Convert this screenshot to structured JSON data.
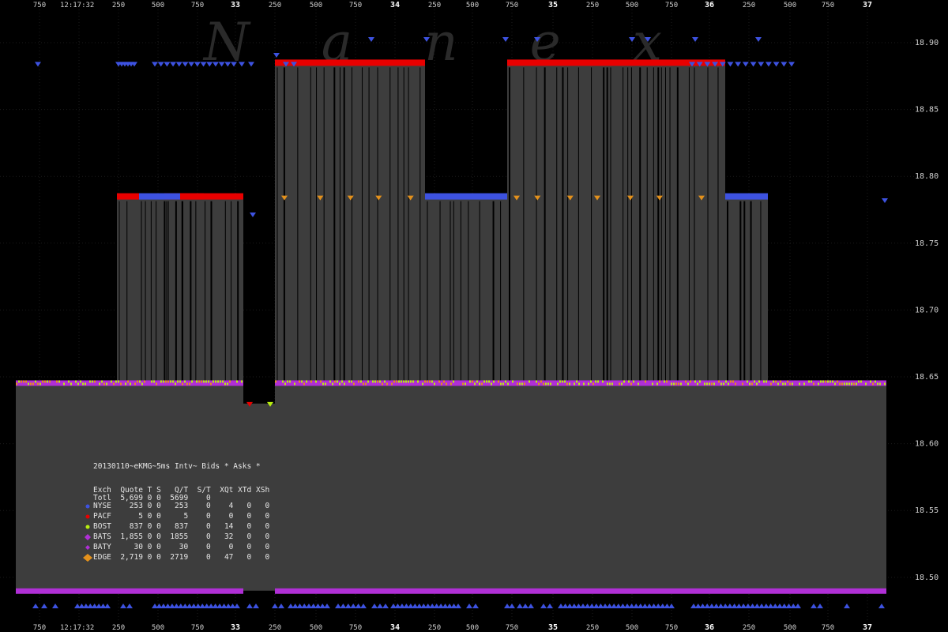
{
  "watermark": "N a n e x",
  "colors": {
    "nyse": "#3d52e0",
    "pacf": "#e80000",
    "bost": "#b8ee10",
    "bats": "#b02fd6",
    "baty": "#b02fd6",
    "edge": "#e3911c",
    "spread_fill": "#3d3d3d",
    "background": "#000000"
  },
  "chart_data": {
    "type": "quote-spread-timeline",
    "time_label": "12:17:32",
    "x_ticks": [
      "750",
      "250",
      "500",
      "750",
      "33",
      "250",
      "500",
      "750",
      "34",
      "250",
      "500",
      "750",
      "35",
      "250",
      "500",
      "750",
      "36",
      "250",
      "500",
      "750",
      "37"
    ],
    "y_ticks": [
      "18.90",
      "18.85",
      "18.80",
      "18.75",
      "18.70",
      "18.65",
      "18.60",
      "18.55",
      "18.50"
    ],
    "ylim": [
      18.48,
      18.91
    ],
    "ask_segments": [
      {
        "x0": 32.55,
        "x1": 32.8,
        "price": 18.785,
        "exch": "pacf"
      },
      {
        "x0": 32.25,
        "x1": 32.39,
        "price": 18.785,
        "exch": "pacf"
      },
      {
        "x0": 32.39,
        "x1": 32.65,
        "price": 18.785,
        "exch": "nyse"
      },
      {
        "x0": 32.65,
        "x1": 33.05,
        "price": 18.785,
        "exch": "pacf"
      },
      {
        "x0": 33.25,
        "x1": 34.2,
        "price": 18.885,
        "exch": "pacf"
      },
      {
        "x0": 34.2,
        "x1": 34.72,
        "price": 18.785,
        "exch": "nyse"
      },
      {
        "x0": 34.72,
        "x1": 35.89,
        "price": 18.885,
        "exch": "pacf"
      },
      {
        "x0": 35.89,
        "x1": 36.1,
        "price": 18.885,
        "exch": "pacf"
      },
      {
        "x0": 36.1,
        "x1": 36.37,
        "price": 18.785,
        "exch": "nyse"
      }
    ],
    "bid_level": 18.645,
    "bid_dip": {
      "x0": 33.05,
      "x1": 33.25,
      "price": 18.63
    },
    "lower_band_price": 18.49,
    "legend": {
      "title": "20130110~eKMG~5ms Intv~ Bids * Asks *",
      "headers": [
        "Exch",
        "Quote",
        "T",
        "S",
        "Q/T",
        "S/T",
        "XQt",
        "XTd",
        "XSh"
      ],
      "total": {
        "exch": "Totl",
        "quote": "5,699",
        "t": "0",
        "s": "0",
        "qt": "5699",
        "st": "0",
        "xqt": "",
        "xtd": "",
        "xsh": ""
      },
      "rows": [
        {
          "exch": "NYSE",
          "quote": "253",
          "t": "0",
          "s": "0",
          "qt": "253",
          "st": "0",
          "xqt": "4",
          "xtd": "0",
          "xsh": "0",
          "color": "#3d52e0",
          "marker": "circle"
        },
        {
          "exch": "PACF",
          "quote": "5",
          "t": "0",
          "s": "0",
          "qt": "5",
          "st": "0",
          "xqt": "0",
          "xtd": "0",
          "xsh": "0",
          "color": "#e80000",
          "marker": "circle"
        },
        {
          "exch": "BOST",
          "quote": "837",
          "t": "0",
          "s": "0",
          "qt": "837",
          "st": "0",
          "xqt": "14",
          "xtd": "0",
          "xsh": "0",
          "color": "#b8ee10",
          "marker": "circle"
        },
        {
          "exch": "BATS",
          "quote": "1,855",
          "t": "0",
          "s": "0",
          "qt": "1855",
          "st": "0",
          "xqt": "32",
          "xtd": "0",
          "xsh": "0",
          "color": "#b02fd6",
          "marker": "diamond"
        },
        {
          "exch": "BATY",
          "quote": "30",
          "t": "0",
          "s": "0",
          "qt": "30",
          "st": "0",
          "xqt": "0",
          "xtd": "0",
          "xsh": "0",
          "color": "#b02fd6",
          "marker": "diamond-small"
        },
        {
          "exch": "EDGE",
          "quote": "2,719",
          "t": "0",
          "s": "0",
          "qt": "2719",
          "st": "0",
          "xqt": "47",
          "xtd": "0",
          "xsh": "0",
          "color": "#e3911c",
          "marker": "diamond-large"
        }
      ]
    }
  }
}
